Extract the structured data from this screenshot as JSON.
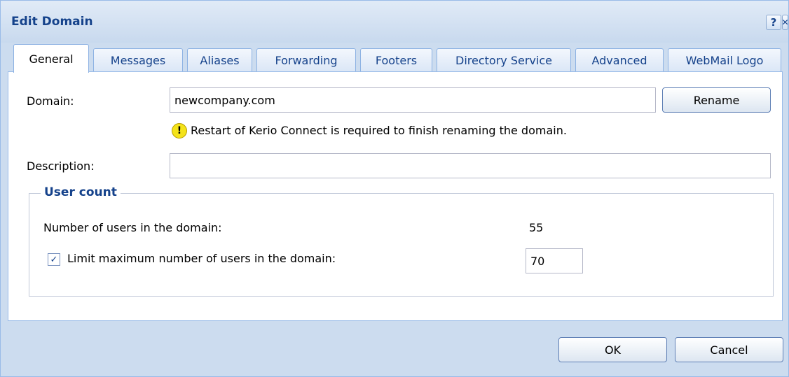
{
  "window": {
    "title": "Edit Domain",
    "help_icon": "?",
    "close_icon": "✕"
  },
  "tabs": [
    {
      "label": "General",
      "active": true
    },
    {
      "label": "Messages"
    },
    {
      "label": "Aliases"
    },
    {
      "label": "Forwarding"
    },
    {
      "label": "Footers"
    },
    {
      "label": "Directory Service"
    },
    {
      "label": "Advanced"
    },
    {
      "label": "WebMail Logo"
    }
  ],
  "general": {
    "domain_label": "Domain:",
    "domain_value": "newcompany.com",
    "rename_label": "Rename",
    "warning_icon": "!",
    "warning_text": "Restart of Kerio Connect is required to finish renaming the domain.",
    "description_label": "Description:",
    "description_value": ""
  },
  "user_count": {
    "legend": "User count",
    "users_label": "Number of users in the domain:",
    "users_value": "55",
    "limit_checked": true,
    "limit_check_glyph": "✓",
    "limit_label": "Limit maximum number of users in the domain:",
    "limit_value": "70"
  },
  "footer": {
    "ok_label": "OK",
    "cancel_label": "Cancel"
  }
}
